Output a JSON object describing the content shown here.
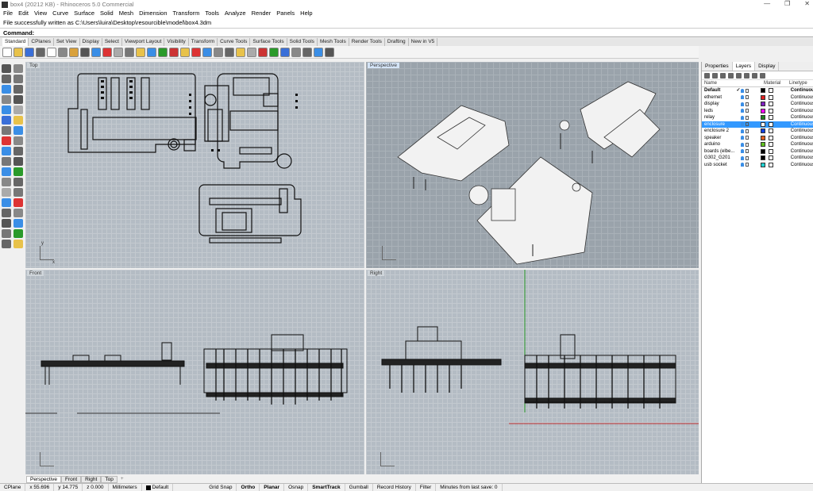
{
  "window": {
    "title": "box4 (20212 KB) - Rhinoceros 5.0 Commercial",
    "controls": [
      "—",
      "❐",
      "✕"
    ]
  },
  "menu": [
    "File",
    "Edit",
    "View",
    "Curve",
    "Surface",
    "Solid",
    "Mesh",
    "Dimension",
    "Transform",
    "Tools",
    "Analyze",
    "Render",
    "Panels",
    "Help"
  ],
  "command_history": "File successfully written as C:\\Users\\luira\\Desktop\\resourcible\\model\\box4.3dm",
  "command_prompt": "Command:",
  "toolbar_tabs": [
    "Standard",
    "CPlanes",
    "Set View",
    "Display",
    "Select",
    "Viewport Layout",
    "Visibility",
    "Transform",
    "Curve Tools",
    "Surface Tools",
    "Solid Tools",
    "Mesh Tools",
    "Render Tools",
    "Drafting",
    "New in V5"
  ],
  "viewports": {
    "top": "Top",
    "perspective": "Perspective",
    "front": "Front",
    "right": "Right"
  },
  "viewport_tabs": [
    "Perspective",
    "Front",
    "Right",
    "Top"
  ],
  "viewport_tab_add": "+",
  "axis_labels": {
    "x": "x",
    "y": "y",
    "z": "z"
  },
  "statusbar": {
    "cplane": "CPlane",
    "x": "x 55.696",
    "y": "y 14.775",
    "z": "z 0.000",
    "units": "Millimeters",
    "layer": "Default",
    "grid_snap": "Grid Snap",
    "ortho": "Ortho",
    "planar": "Planar",
    "osnap": "Osnap",
    "smarttrack": "SmartTrack",
    "gumball": "Gumball",
    "record_history": "Record History",
    "filter": "Filter",
    "save_info": "Minutes from last save: 0"
  },
  "panel": {
    "tabs": [
      "Properties",
      "Layers",
      "Display"
    ],
    "columns": {
      "name": "Name",
      "material": "Material",
      "linetype": "Linetype"
    },
    "layers": [
      {
        "name": "Default",
        "current": "✓",
        "color": "#000000",
        "linetype": "Continuous"
      },
      {
        "name": "ethernet",
        "current": "",
        "color": "#e02020",
        "linetype": "Continuous"
      },
      {
        "name": "display",
        "current": "",
        "color": "#8020c0",
        "linetype": "Continuous"
      },
      {
        "name": "leds",
        "current": "",
        "color": "#ff00ff",
        "linetype": "Continuous"
      },
      {
        "name": "relay",
        "current": "",
        "color": "#208020",
        "linetype": "Continuous"
      },
      {
        "name": "enclosure",
        "current": "",
        "color": "#ffffff",
        "linetype": "Continuous"
      },
      {
        "name": "enclosure 2",
        "current": "",
        "color": "#1040e0",
        "linetype": "Continuous"
      },
      {
        "name": "speaker",
        "current": "",
        "color": "#e06020",
        "linetype": "Continuous"
      },
      {
        "name": "arduino",
        "current": "",
        "color": "#60c020",
        "linetype": "Continuous"
      },
      {
        "name": "boards (elbe...",
        "current": "",
        "color": "#000000",
        "linetype": "Continuous"
      },
      {
        "name": "G302_G201",
        "current": "",
        "color": "#000000",
        "linetype": "Continuous"
      },
      {
        "name": "usb socket",
        "current": "",
        "color": "#20d0d0",
        "linetype": "Continuous"
      }
    ]
  }
}
